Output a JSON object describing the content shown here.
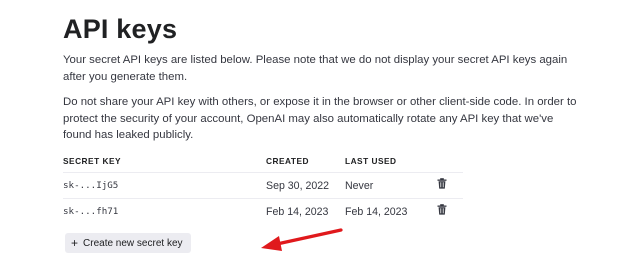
{
  "page": {
    "title": "API keys",
    "description_1": "Your secret API keys are listed below. Please note that we do not display your secret API keys again after you generate them.",
    "description_2": "Do not share your API key with others, or expose it in the browser or other client-side code. In order to protect the security of your account, OpenAI may also automatically rotate any API key that we've found has leaked publicly."
  },
  "table": {
    "headers": {
      "secret_key": "SECRET KEY",
      "created": "CREATED",
      "last_used": "LAST USED"
    },
    "rows": [
      {
        "secret_key": "sk-...IjG5",
        "created": "Sep 30, 2022",
        "last_used": "Never",
        "action_icon": "trash-icon"
      },
      {
        "secret_key": "sk-...fh71",
        "created": "Feb 14, 2023",
        "last_used": "Feb 14, 2023",
        "action_icon": "trash-icon"
      }
    ]
  },
  "create_button": {
    "icon": "plus-icon",
    "label": "Create new secret key"
  },
  "annotation": {
    "arrow_color": "#e0191c"
  },
  "colors": {
    "button_bg": "#ececf1",
    "text": "#202123"
  }
}
